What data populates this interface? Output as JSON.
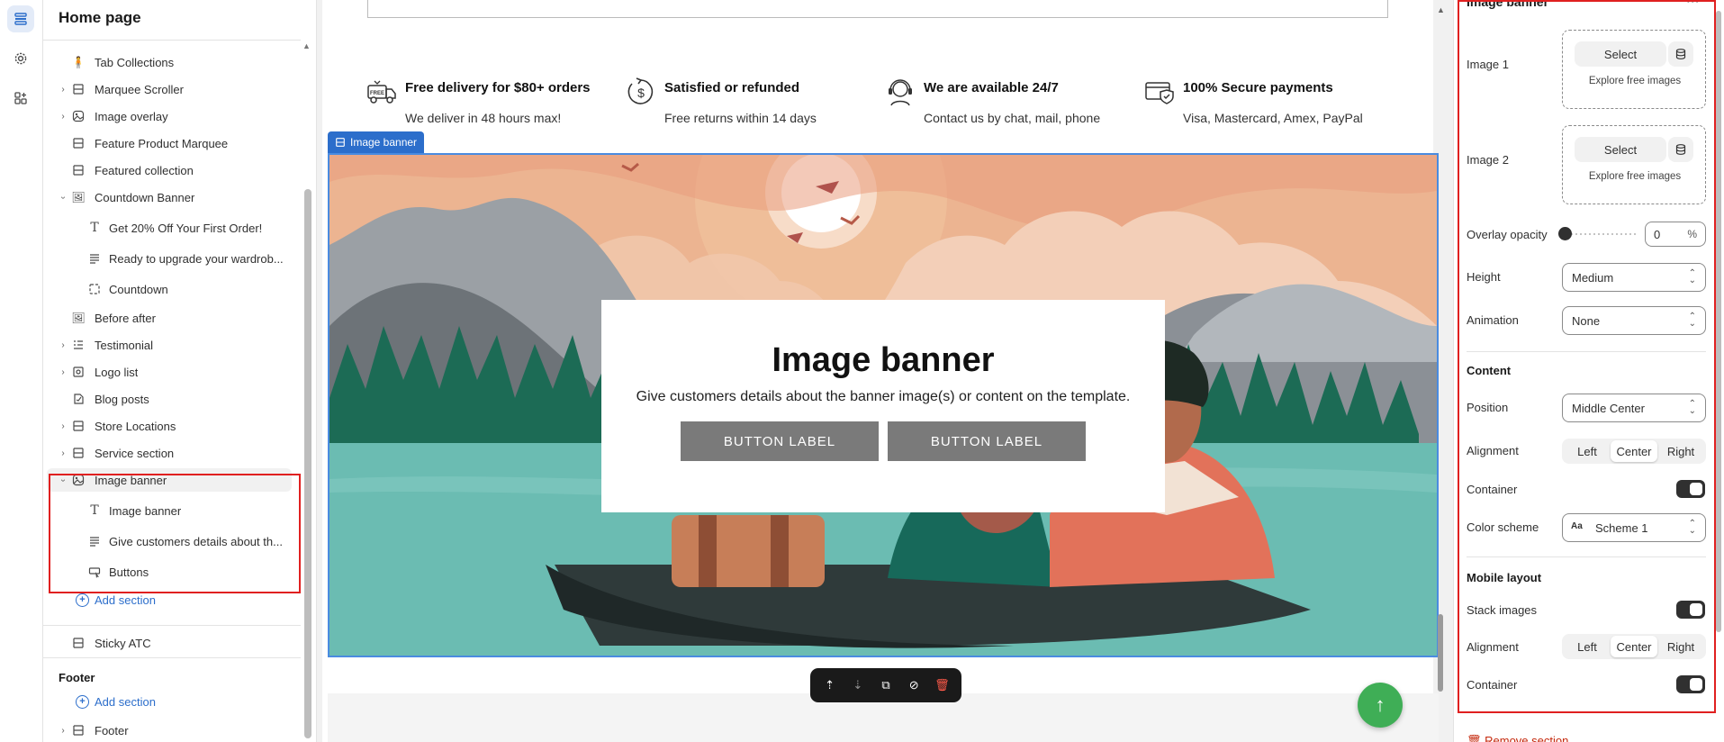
{
  "sidebar": {
    "title": "Home page",
    "items": [
      {
        "label": "Tab Collections"
      },
      {
        "label": "Marquee Scroller"
      },
      {
        "label": "Image overlay"
      },
      {
        "label": "Feature Product Marquee"
      },
      {
        "label": "Featured collection"
      },
      {
        "label": "Countdown Banner"
      },
      {
        "label": "Get 20% Off Your First Order!"
      },
      {
        "label": "Ready to upgrade your wardrob..."
      },
      {
        "label": "Countdown"
      },
      {
        "label": "Before after"
      },
      {
        "label": "Testimonial"
      },
      {
        "label": "Logo list"
      },
      {
        "label": "Blog posts"
      },
      {
        "label": "Store Locations"
      },
      {
        "label": "Service section"
      },
      {
        "label": "Image banner"
      },
      {
        "label": "Image banner"
      },
      {
        "label": "Give customers details about th..."
      },
      {
        "label": "Buttons"
      }
    ],
    "add_section": "Add section",
    "sticky_atc": "Sticky ATC",
    "footer_heading": "Footer",
    "footer_add_section": "Add section",
    "footer_item": "Footer"
  },
  "features": [
    {
      "title": "Free delivery for $80+ orders",
      "subtitle": "We deliver in 48 hours max!",
      "icon": "delivery-truck-icon"
    },
    {
      "title": "Satisfied or refunded",
      "subtitle": "Free returns within 14 days",
      "icon": "dollar-refund-icon"
    },
    {
      "title": "We are available 24/7",
      "subtitle": "Contact us by chat, mail, phone",
      "icon": "support-agent-icon"
    },
    {
      "title": "100% Secure payments",
      "subtitle": "Visa, Mastercard, Amex, PayPal",
      "icon": "secure-card-icon"
    }
  ],
  "banner": {
    "tag": "Image banner",
    "heading": "Image banner",
    "text": "Give customers details about the banner image(s) or content on the template.",
    "button1": "BUTTON LABEL",
    "button2": "BUTTON LABEL"
  },
  "panel": {
    "title": "Image banner",
    "image1_label": "Image 1",
    "image2_label": "Image 2",
    "select_label": "Select",
    "explore_label": "Explore free images",
    "overlay_label": "Overlay opacity",
    "overlay_value": "0",
    "overlay_unit": "%",
    "height_label": "Height",
    "height_value": "Medium",
    "animation_label": "Animation",
    "animation_value": "None",
    "content_heading": "Content",
    "position_label": "Position",
    "position_value": "Middle Center",
    "alignment_label": "Alignment",
    "align_left": "Left",
    "align_center": "Center",
    "align_right": "Right",
    "container_label": "Container",
    "color_scheme_label": "Color scheme",
    "color_scheme_value": "Scheme 1",
    "mobile_heading": "Mobile layout",
    "stack_label": "Stack images",
    "m_alignment_label": "Alignment",
    "m_align_left": "Left",
    "m_align_center": "Center",
    "m_align_right": "Right",
    "m_container_label": "Container",
    "remove_label": "Remove section"
  },
  "colors": {
    "accent": "#2c6ecb",
    "highlight": "#e02020",
    "fab": "#3fae56"
  }
}
